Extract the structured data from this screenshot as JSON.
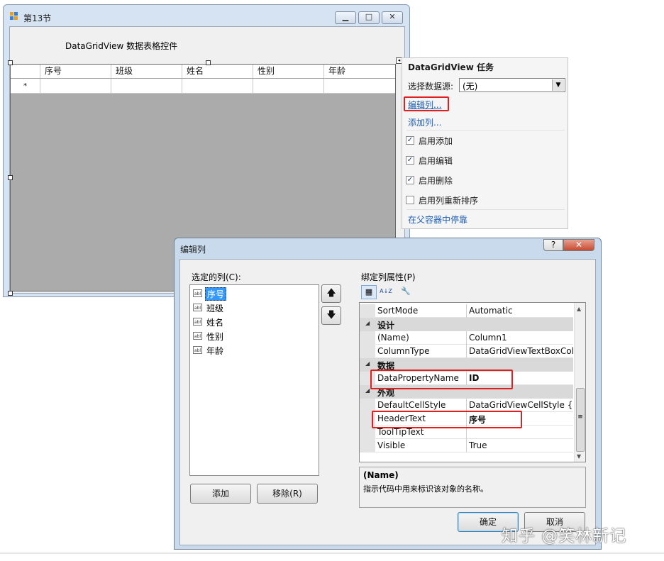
{
  "form": {
    "title": "第13节",
    "heading": "DataGridView 数据表格控件",
    "min_glyph": "▁",
    "max_glyph": "□",
    "close_glyph": "✕",
    "grid": {
      "columns": [
        "序号",
        "班级",
        "姓名",
        "性别",
        "年龄"
      ],
      "new_row_marker": "*"
    }
  },
  "tasks_panel": {
    "title": "DataGridView 任务",
    "datasource_label": "选择数据源:",
    "datasource_value": "(无)",
    "edit_columns_link": "编辑列...",
    "add_column_link": "添加列...",
    "checkboxes": [
      {
        "label": "启用添加",
        "checked": true
      },
      {
        "label": "启用编辑",
        "checked": true
      },
      {
        "label": "启用删除",
        "checked": true
      },
      {
        "label": "启用列重新排序",
        "checked": false
      }
    ],
    "dock_link": "在父容器中停靠",
    "check_glyph": "✓"
  },
  "dialog": {
    "title": "编辑列",
    "help_glyph": "?",
    "close_glyph": "✕",
    "selected_columns_label": "选定的列(C):",
    "selected_columns": [
      "序号",
      "班级",
      "姓名",
      "性别",
      "年龄"
    ],
    "selected_index": 0,
    "column_icon_text": "abl",
    "up_glyph": "🡅",
    "down_glyph": "🡇",
    "add_button": "添加",
    "remove_button": "移除(R)",
    "bound_props_label": "绑定列属性(P)",
    "toolbar": {
      "categorized": "▦",
      "alphabetical": "A↓Z",
      "pages": "🔧"
    },
    "property_grid": [
      {
        "kind": "prop",
        "name": "SortMode",
        "value": "Automatic"
      },
      {
        "kind": "cat",
        "name": "设计"
      },
      {
        "kind": "prop",
        "name": "(Name)",
        "value": "Column1"
      },
      {
        "kind": "prop",
        "name": "ColumnType",
        "value": "DataGridViewTextBoxColumn"
      },
      {
        "kind": "cat",
        "name": "数据"
      },
      {
        "kind": "prop",
        "name": "DataPropertyName",
        "value": "ID",
        "bold": true
      },
      {
        "kind": "cat",
        "name": "外观"
      },
      {
        "kind": "prop",
        "name": "DefaultCellStyle",
        "value": "DataGridViewCellStyle { }"
      },
      {
        "kind": "prop",
        "name": "HeaderText",
        "value": "序号",
        "bold": true
      },
      {
        "kind": "prop",
        "name": "ToolTipText",
        "value": ""
      },
      {
        "kind": "prop",
        "name": "Visible",
        "value": "True"
      }
    ],
    "cat_glyph": "◢",
    "desc_title": "(Name)",
    "desc_text": "指示代码中用来标识该对象的名称。",
    "ok_button": "确定",
    "cancel_button": "取消",
    "scroll_up_glyph": "▲",
    "scroll_down_glyph": "▼",
    "scroll_grip_glyph": "≡"
  },
  "watermark": "知乎 @笑林新记",
  "colors": {
    "highlight_red": "#e02020",
    "link_blue": "#1f5fb0",
    "selection_blue": "#3399ff"
  }
}
